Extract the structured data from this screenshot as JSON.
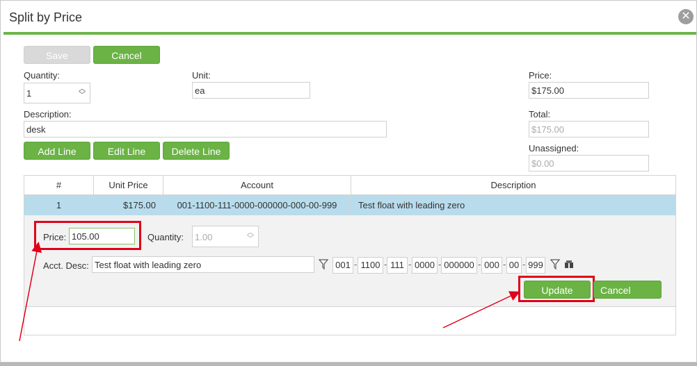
{
  "dialog": {
    "title": "Split by Price",
    "close_glyph": "✕"
  },
  "toolbar": {
    "save_label": "Save",
    "cancel_label": "Cancel"
  },
  "form": {
    "quantity_label": "Quantity:",
    "quantity_value": "1",
    "unit_label": "Unit:",
    "unit_value": "ea",
    "price_label": "Price:",
    "price_value": "$175.00",
    "description_label": "Description:",
    "description_value": "desk",
    "total_label": "Total:",
    "total_value": "$175.00",
    "unassigned_label": "Unassigned:",
    "unassigned_value": "$0.00"
  },
  "line_buttons": {
    "add": "Add Line",
    "edit": "Edit Line",
    "delete": "Delete Line"
  },
  "grid": {
    "headers": [
      "#",
      "Unit Price",
      "Account",
      "Description"
    ],
    "rows": [
      {
        "num": "1",
        "unit_price": "$175.00",
        "account": "001-1100-111-0000-000000-000-00-999",
        "description": "Test float with leading zero"
      }
    ]
  },
  "editor": {
    "price_label": "Price:",
    "price_value": "105.00",
    "quantity_label": "Quantity:",
    "quantity_value": "1.00",
    "acct_label": "Acct. Desc:",
    "acct_value": "Test float with leading zero",
    "segments": [
      "001",
      "1100",
      "111",
      "0000",
      "000000",
      "000",
      "00",
      "999"
    ],
    "update_label": "Update",
    "cancel_label": "Cancel"
  },
  "colors": {
    "accent": "#6ab344",
    "highlight": "#e0001a",
    "selected_row": "#b8dcec"
  },
  "icons": [
    "close-icon",
    "filter-icon",
    "spinner-up-icon",
    "spinner-down-icon",
    "lookup-icon"
  ]
}
